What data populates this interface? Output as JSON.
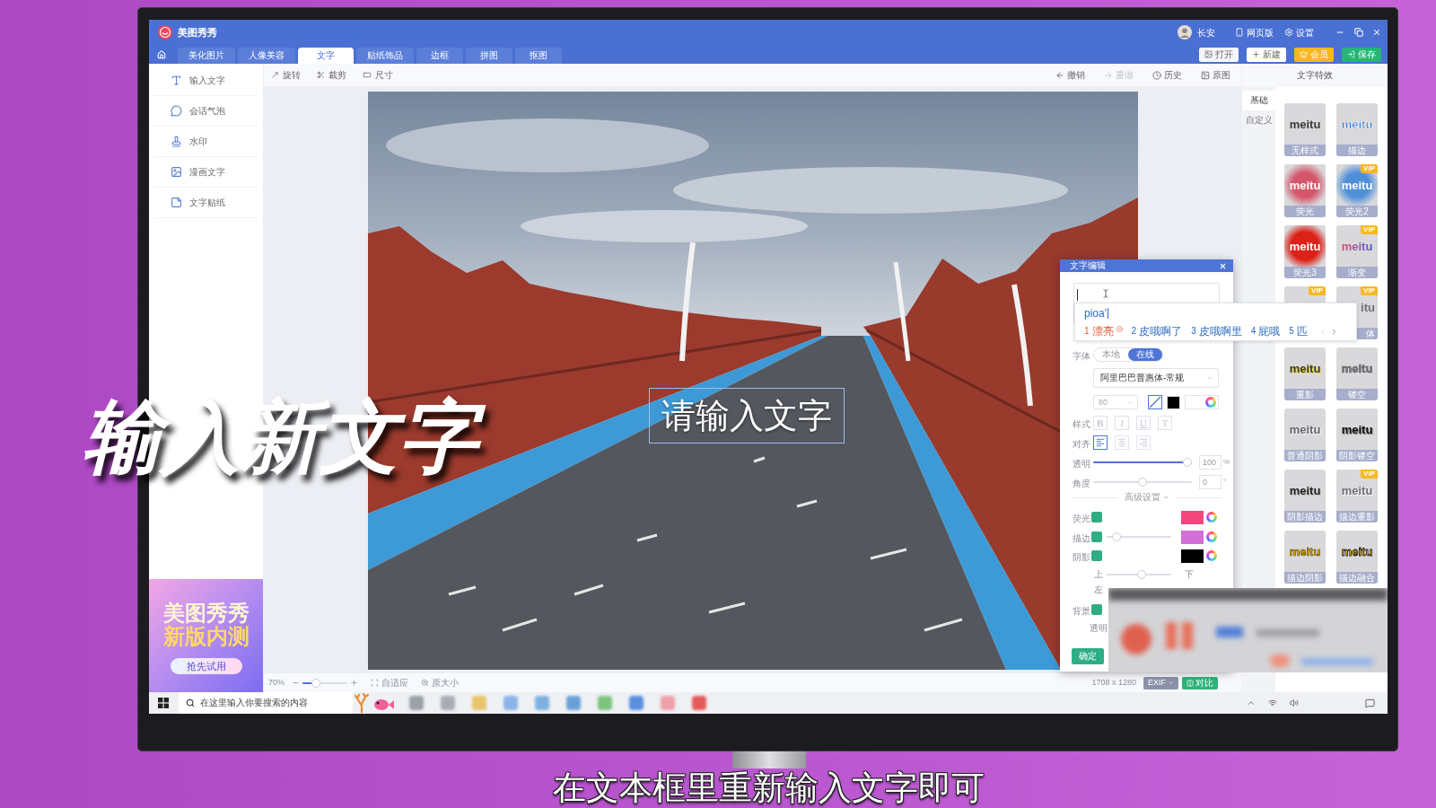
{
  "window": {
    "title": "美图秀秀",
    "account": "长安",
    "web_version": "网页版",
    "settings": "设置"
  },
  "tabs": [
    {
      "label": "美化图片",
      "selected": false
    },
    {
      "label": "人像美容",
      "selected": false
    },
    {
      "label": "文字",
      "selected": true
    },
    {
      "label": "贴纸饰品",
      "selected": false
    },
    {
      "label": "边框",
      "selected": false
    },
    {
      "label": "拼图",
      "selected": false
    },
    {
      "label": "抠图",
      "selected": false
    }
  ],
  "header_buttons": [
    {
      "kind": "open",
      "label": "打开"
    },
    {
      "kind": "new",
      "label": "新建"
    },
    {
      "kind": "vip",
      "label": "会员"
    },
    {
      "kind": "save",
      "label": "保存"
    }
  ],
  "toolbar": {
    "tools": [
      {
        "label": "旋转"
      },
      {
        "label": "裁剪"
      },
      {
        "label": "尺寸"
      }
    ],
    "history": [
      {
        "label": "撤销",
        "disabled": false
      },
      {
        "label": "重做",
        "disabled": true
      },
      {
        "label": "历史",
        "disabled": false
      },
      {
        "label": "原图",
        "disabled": false
      }
    ]
  },
  "sidebar": {
    "items": [
      {
        "label": "输入文字"
      },
      {
        "label": "会话气泡"
      },
      {
        "label": "水印"
      },
      {
        "label": "漫画文字"
      },
      {
        "label": "文字贴纸"
      }
    ],
    "promo": {
      "title": "美图秀秀",
      "subtitle": "新版内测",
      "button": "抢先试用"
    }
  },
  "canvas": {
    "text_layer": "请输入文字"
  },
  "status_bar": {
    "zoom": "70%",
    "zoom_slider": {
      "level": 0.25
    },
    "fit": "自适应",
    "actual_size": "原大小",
    "dimensions": "1708 x 1280",
    "exif": "EXIF",
    "compare": "对比"
  },
  "effects_panel": {
    "title": "文字特效",
    "tabs": [
      {
        "label": "基础",
        "selected": true
      },
      {
        "label": "自定义",
        "selected": false
      }
    ],
    "tile_rows": [
      [
        {
          "kind": "plain",
          "sample": "meitu",
          "label": "无样式"
        },
        {
          "kind": "outline",
          "sample": "meitu",
          "label": "描边"
        }
      ],
      [
        {
          "kind": "glow",
          "sample": "meitu",
          "label": "荧光"
        },
        {
          "kind": "glow2",
          "sample": "meitu",
          "label": "荧光2",
          "badge": "VIP"
        }
      ],
      [
        {
          "kind": "glow3",
          "sample": "meitu",
          "label": "荧光3"
        },
        {
          "kind": "gradient",
          "sample": "meitu",
          "label": "渐变",
          "badge": "VIP"
        }
      ],
      [
        {
          "kind": "covered",
          "badge": "VIP"
        },
        {
          "kind": "covered",
          "sample": "itu",
          "label": "体",
          "badge": "VIP"
        }
      ],
      [
        {
          "kind": "ghost",
          "sample": "meitu",
          "label": "重影"
        },
        {
          "kind": "hollow",
          "sample": "meitu",
          "label": "镂空"
        }
      ],
      [
        {
          "kind": "shadow",
          "sample": "meitu",
          "label": "普通阴影"
        },
        {
          "kind": "shadow-hollow",
          "sample": "meitu",
          "label": "阴影镂空"
        }
      ],
      [
        {
          "kind": "shadow-outline",
          "sample": "meitu",
          "label": "阴影描边"
        },
        {
          "kind": "outline-ghost",
          "sample": "meitu",
          "label": "描边重影",
          "badge": "VIP"
        }
      ],
      [
        {
          "kind": "outline-shadow",
          "sample": "meitu",
          "label": "描边阴影"
        },
        {
          "kind": "outline-blend",
          "sample": "meitu",
          "label": "描边融合"
        }
      ]
    ]
  },
  "text_dialog": {
    "title": "文字编辑",
    "font": {
      "label": "字体",
      "sources": [
        {
          "label": "本地",
          "selected": false
        },
        {
          "label": "在线",
          "selected": true
        }
      ],
      "family": "阿里巴巴普惠体-常规",
      "size": "80"
    },
    "colors": [
      {
        "kind": "none",
        "selected": true
      },
      {
        "kind": "solid",
        "color": "#000000",
        "selected": false
      },
      {
        "kind": "custom",
        "selected": false
      }
    ],
    "style": {
      "label": "样式",
      "buttons": [
        "B",
        "I",
        "U",
        "T"
      ]
    },
    "align": {
      "label": "对齐",
      "options": [
        {
          "selected": true
        },
        {
          "selected": false
        },
        {
          "selected": false
        }
      ]
    },
    "opacity": {
      "label": "透明",
      "level": 1,
      "value": "100",
      "unit": "%"
    },
    "angle": {
      "label": "角度",
      "level": 0.5,
      "value": "0",
      "unit": "°"
    },
    "advanced": "高级设置",
    "glow": {
      "label": "荧光",
      "checked": true,
      "color": "#f2467e"
    },
    "stroke": {
      "label": "描边",
      "checked": true,
      "level": 0.1,
      "color": "#d36fd6"
    },
    "shadow": {
      "label": "阴影",
      "checked": true,
      "color": "#000000",
      "offset_y": {
        "start": "上",
        "end": "下",
        "level": 0.55
      },
      "offset_x": {
        "start": "左"
      }
    },
    "background": {
      "label": "背景",
      "checked": true,
      "opacity_label": "透明"
    },
    "confirm": "确定"
  },
  "ime": {
    "composition": "pioa'",
    "candidates": [
      {
        "index": "1",
        "text": "漂亮",
        "selected": true
      },
      {
        "index": "2",
        "text": "皮哦啊了",
        "selected": false
      },
      {
        "index": "3",
        "text": "皮哦啊里",
        "selected": false
      },
      {
        "index": "4",
        "text": "屁哦",
        "selected": false
      },
      {
        "index": "5",
        "text": "匹",
        "selected": false
      }
    ]
  },
  "taskbar": {
    "search_placeholder": "在这里输入你要搜索的内容"
  },
  "captions": {
    "overlay": "输入新文字",
    "subtitle": "在文本框里重新输入文字即可"
  }
}
